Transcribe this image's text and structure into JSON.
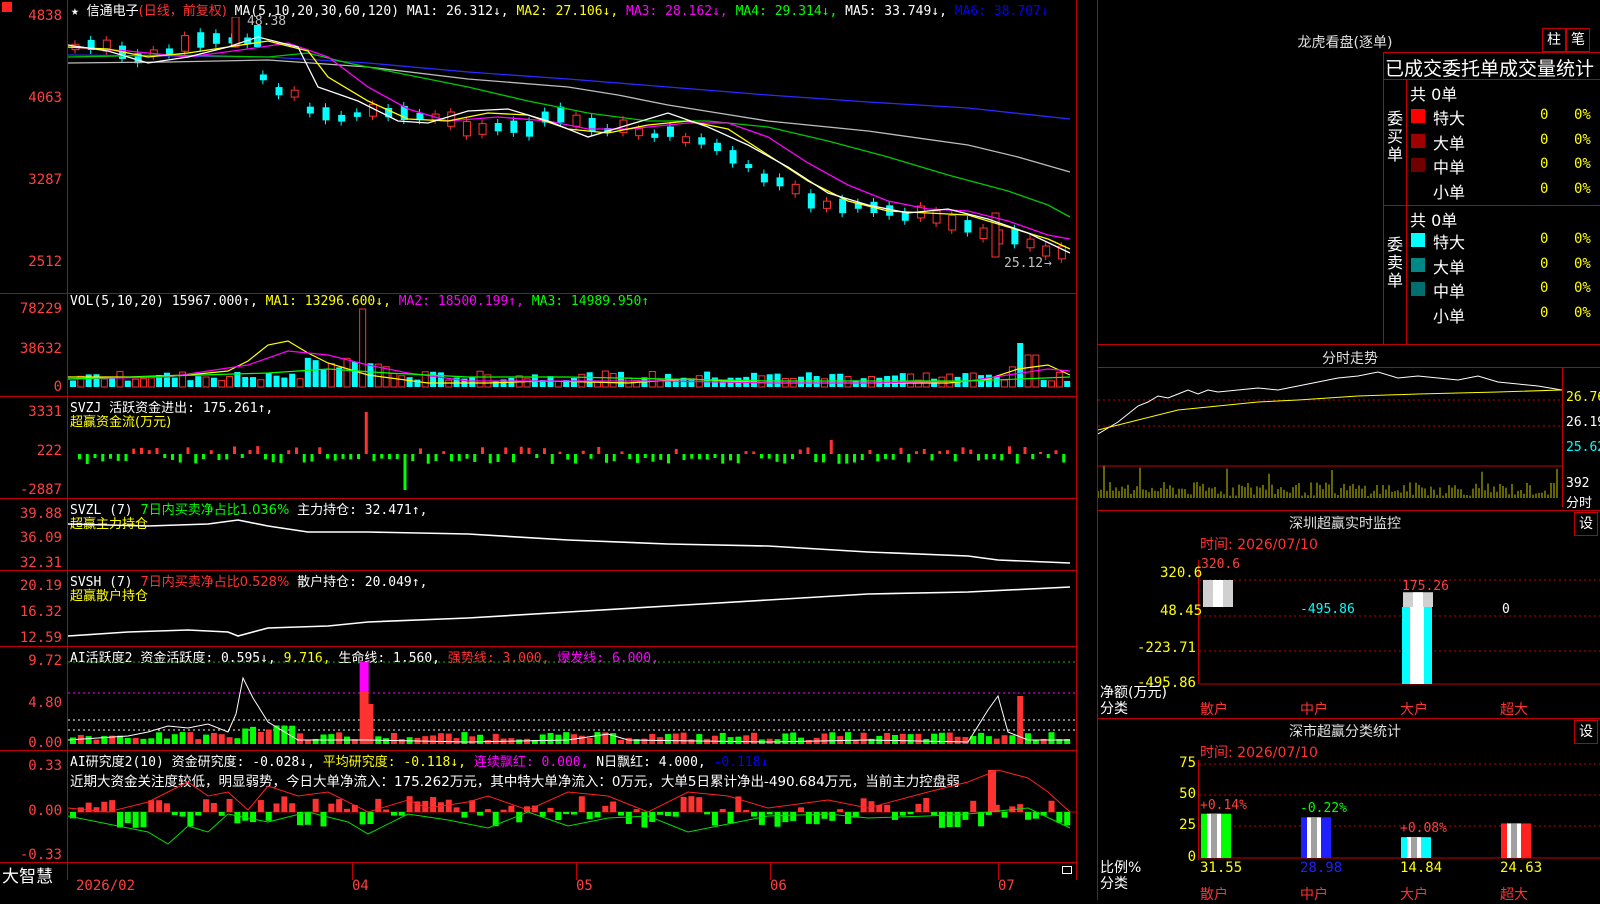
{
  "header": {
    "logo_icon": "red-square-icon",
    "price_top": "4838",
    "star": "★",
    "stock_name": "信通电子",
    "mode": "(日线，前复权)",
    "ma_label": "MA(5,10,20,30,60,120)",
    "ma1": "MA1: 26.312↓,",
    "ma2": "MA2: 27.106↓,",
    "ma3": "MA3: 28.162↓,",
    "ma4": "MA4: 29.314↓,",
    "ma5": "MA5: 33.749↓,",
    "ma6": "MA6: 38.707↓",
    "high_mark": "48.38",
    "low_mark": "25.12"
  },
  "price_axis": [
    "4838",
    "4063",
    "3287",
    "2512"
  ],
  "vol": {
    "label": "VOL(5,10,20)",
    "value": "15967.000↑,",
    "ma1": "MA1: 13296.600↓,",
    "ma2": "MA2: 18500.199↑,",
    "ma3": "MA3: 14989.950↑",
    "axis": [
      "78229",
      "38632",
      "0"
    ]
  },
  "svzj": {
    "label": "SVZJ",
    "value": "活跃资金进出: 175.261↑,",
    "subtitle": "超赢资金流(万元)",
    "axis": [
      "3331",
      "222",
      "-2887"
    ]
  },
  "svzl": {
    "label": "SVZL (7)",
    "ratio": "7日内买卖净占比1.036%",
    "value": "主力持仓: 32.471↑,",
    "subtitle": "超赢主力持仓",
    "axis": [
      "39.88",
      "36.09",
      "32.31"
    ]
  },
  "svsh": {
    "label": "SVSH (7)",
    "ratio": "7日内买卖净占比0.528%",
    "value": "散户持仓: 20.049↑,",
    "subtitle": "超赢散户持仓",
    "axis": [
      "20.19",
      "16.32",
      "12.59"
    ]
  },
  "ai_active": {
    "label": "AI活跃度2",
    "value": "资金活跃度: 0.595↓,",
    "v2": "9.716,",
    "life": "生命线: 1.560,",
    "strong": "强势线: 3.000,",
    "burst": "爆发线: 6.000,",
    "axis": [
      "9.72",
      "4.80",
      "0.00"
    ]
  },
  "ai_research": {
    "label": "AI研究度2(10)",
    "value": "资金研究度: -0.028↓,",
    "avg": "平均研究度: -0.118↓,",
    "cont": "连续飘红: 0.000,",
    "nday": "N日飘红: 4.000,",
    "last": "-0.118↓",
    "comment": "近期大资金关注度较低，明显弱势，今日大单净流入：175.262万元，其中特大单净流入：0万元，大单5日累计净出-490.684万元，当前主力控盘弱",
    "axis": [
      "0.33",
      "0.00",
      "-0.33"
    ]
  },
  "x_axis": {
    "brand": "大智慧",
    "labels": [
      "2026/02",
      "04",
      "05",
      "06",
      "07"
    ]
  },
  "lhb": {
    "title": "龙虎看盘(逐单)",
    "btn1": "柱",
    "btn2": "笔",
    "stats_title": "已成交委托单成交量统计",
    "buy_label": "委买单",
    "sell_label": "委卖单",
    "buy_total": "共 0单",
    "sell_total": "共 0单",
    "buy_rows": [
      {
        "name": "特大",
        "count": "0",
        "pct": "0%",
        "color": "#ff0000"
      },
      {
        "name": "大单",
        "count": "0",
        "pct": "0%",
        "color": "#a00000"
      },
      {
        "name": "中单",
        "count": "0",
        "pct": "0%",
        "color": "#700000"
      },
      {
        "name": "小单",
        "count": "0",
        "pct": "0%",
        "color": ""
      }
    ],
    "sell_rows": [
      {
        "name": "特大",
        "count": "0",
        "pct": "0%",
        "color": "#00ffff"
      },
      {
        "name": "大单",
        "count": "0",
        "pct": "0%",
        "color": "#008888"
      },
      {
        "name": "中单",
        "count": "0",
        "pct": "0%",
        "color": "#006e6e"
      },
      {
        "name": "小单",
        "count": "0",
        "pct": "0%",
        "color": ""
      }
    ]
  },
  "intraday": {
    "title": "分时走势",
    "axis": [
      "26.76",
      "26.19",
      "25.62"
    ],
    "vol_label": "392",
    "unit": "分时"
  },
  "monitor": {
    "title": "深圳超赢实时监控",
    "btn": "设",
    "time": "时间: 2026/07/10",
    "axis": [
      "320.6",
      "48.45",
      "-223.71",
      "-495.86"
    ],
    "unit_label": "净额(万元)",
    "cat_label": "分类",
    "bars": [
      {
        "name": "散户",
        "value": 320.6,
        "label": "320.6"
      },
      {
        "name": "中户",
        "value": -495.86,
        "label": "-495.86"
      },
      {
        "name": "大户",
        "value": 175.26,
        "label": "175.26"
      },
      {
        "name": "超大",
        "value": 0,
        "label": "0"
      }
    ]
  },
  "classify": {
    "title": "深市超赢分类统计",
    "btn": "设",
    "time": "时间: 2026/07/10",
    "axis": [
      "75",
      "50",
      "25",
      "0"
    ],
    "unit_label": "比例%",
    "cat_label": "分类",
    "bars": [
      {
        "name": "散户",
        "value": 31.55,
        "label": "31.55",
        "change": "+0.14%",
        "color": "#00ff00"
      },
      {
        "name": "中户",
        "value": 28.98,
        "label": "28.98",
        "change": "-0.22%",
        "color": "#2020ff"
      },
      {
        "name": "大户",
        "value": 14.84,
        "label": "14.84",
        "change": "+0.08%",
        "color": "#00ffff"
      },
      {
        "name": "超大",
        "value": 24.63,
        "label": "24.63",
        "change": "",
        "color": "#ff2020"
      }
    ]
  }
}
